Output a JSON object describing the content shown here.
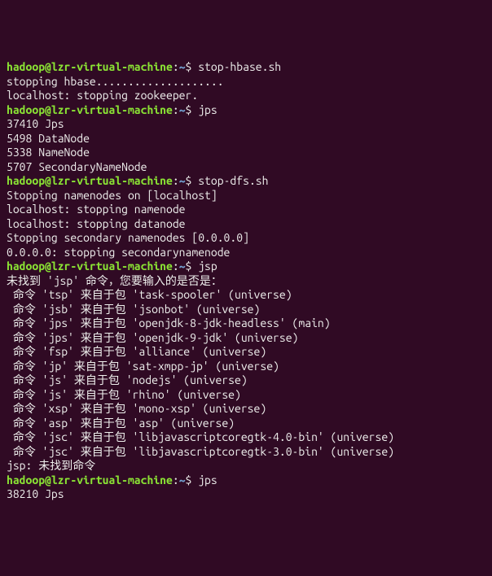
{
  "prompt": {
    "user_host": "hadoop@lzr-virtual-machine",
    "colon": ":",
    "path": "~",
    "sep": "$ "
  },
  "blocks": [
    {
      "cmd": "stop-hbase.sh",
      "out": [
        "stopping hbase....................",
        "localhost: stopping zookeeper."
      ]
    },
    {
      "cmd": "jps",
      "out": [
        "37410 Jps",
        "5498 DataNode",
        "5338 NameNode",
        "5707 SecondaryNameNode"
      ]
    },
    {
      "cmd": "stop-dfs.sh",
      "out": [
        "Stopping namenodes on [localhost]",
        "localhost: stopping namenode",
        "localhost: stopping datanode",
        "Stopping secondary namenodes [0.0.0.0]",
        "0.0.0.0: stopping secondarynamenode"
      ]
    },
    {
      "cmd": "jsp",
      "out": [
        "未找到 'jsp' 命令，您要输入的是否是：",
        " 命令 'tsp' 来自于包 'task-spooler' (universe)",
        " 命令 'jsb' 来自于包 'jsonbot' (universe)",
        " 命令 'jps' 来自于包 'openjdk-8-jdk-headless' (main)",
        " 命令 'jps' 来自于包 'openjdk-9-jdk' (universe)",
        " 命令 'fsp' 来自于包 'alliance' (universe)",
        " 命令 'jp' 来自于包 'sat-xmpp-jp' (universe)",
        " 命令 'js' 来自于包 'nodejs' (universe)",
        " 命令 'js' 来自于包 'rhino' (universe)",
        " 命令 'xsp' 来自于包 'mono-xsp' (universe)",
        " 命令 'asp' 来自于包 'asp' (universe)",
        " 命令 'jsc' 来自于包 'libjavascriptcoregtk-4.0-bin' (universe)",
        " 命令 'jsc' 来自于包 'libjavascriptcoregtk-3.0-bin' (universe)",
        "jsp: 未找到命令"
      ]
    },
    {
      "cmd": "jps",
      "out": [
        "38210 Jps"
      ]
    }
  ]
}
